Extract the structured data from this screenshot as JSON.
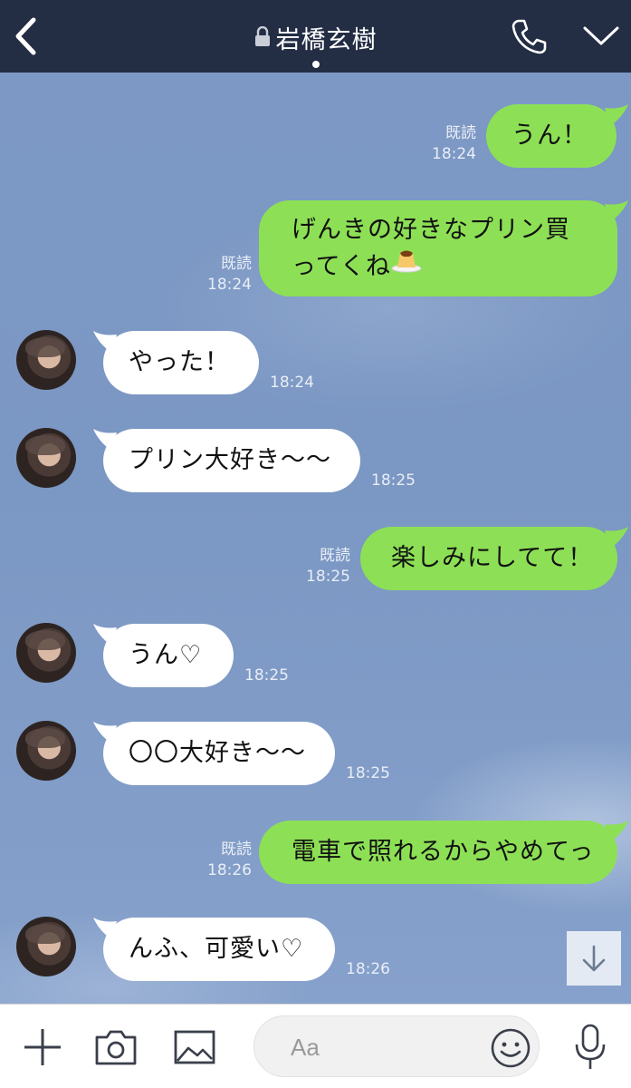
{
  "header": {
    "title": "岩橋玄樹",
    "back_icon": "chevron-left-icon",
    "call_icon": "phone-icon",
    "menu_icon": "chevron-down-icon",
    "lock_icon": "lock-icon"
  },
  "colors": {
    "header_bg": "#232d44",
    "chat_bg": "#7f9cc6",
    "outgoing_bubble": "#8de055",
    "incoming_bubble": "#ffffff"
  },
  "messages": [
    {
      "side": "out",
      "text": "うん！",
      "read": "既読",
      "time": "18:24"
    },
    {
      "side": "out",
      "text": "げんきの好きなプリン買ってくね",
      "emoji": "pudding-icon",
      "read": "既読",
      "time": "18:24"
    },
    {
      "side": "in",
      "text": "やった！",
      "time": "18:24"
    },
    {
      "side": "in",
      "text": "プリン大好き〜〜",
      "time": "18:25"
    },
    {
      "side": "out",
      "text": "楽しみにしてて！",
      "read": "既読",
      "time": "18:25"
    },
    {
      "side": "in",
      "text": "うん♡",
      "time": "18:25"
    },
    {
      "side": "in",
      "text": "〇〇大好き〜〜",
      "time": "18:25"
    },
    {
      "side": "out",
      "text": "電車で照れるからやめてっ",
      "read": "既読",
      "time": "18:26"
    },
    {
      "side": "in",
      "text": "んふ、可愛い♡",
      "time": "18:26"
    }
  ],
  "scroll_button": {
    "icon": "arrow-down-icon"
  },
  "footer": {
    "add_icon": "plus-icon",
    "camera_icon": "camera-icon",
    "image_icon": "image-icon",
    "input_placeholder": "Aa",
    "emoji_icon": "smiley-icon",
    "mic_icon": "microphone-icon"
  }
}
